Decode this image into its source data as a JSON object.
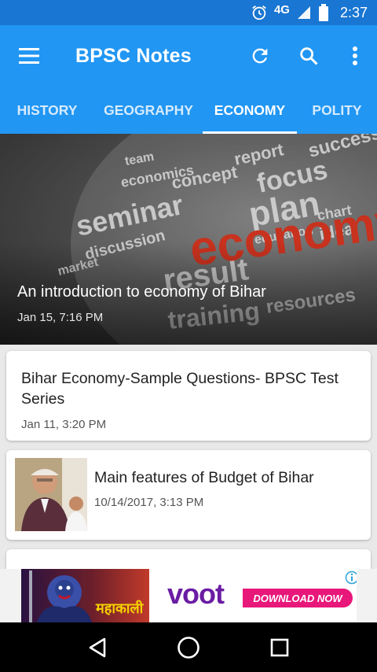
{
  "status_bar": {
    "network": "4G",
    "time": "2:37"
  },
  "app_bar": {
    "title": "BPSC Notes",
    "icons": [
      "menu-icon",
      "refresh-icon",
      "search-icon",
      "more-vert-icon"
    ]
  },
  "tabs": [
    {
      "label": "HISTORY",
      "active": false
    },
    {
      "label": "GEOGRAPHY",
      "active": false
    },
    {
      "label": "ECONOMY",
      "active": true
    },
    {
      "label": "POLITY",
      "active": false
    }
  ],
  "featured": {
    "title": "An introduction to economy of Bihar",
    "date": "Jan 15, 7:16 PM",
    "image_words": [
      "report",
      "success",
      "concept",
      "focus",
      "plan",
      "team",
      "seminar",
      "economy",
      "education",
      "chart",
      "idea",
      "discussion",
      "market",
      "result",
      "resources",
      "training",
      "economics"
    ]
  },
  "posts": [
    {
      "title": "Bihar Economy-Sample Questions- BPSC Test Series",
      "date": "Jan 11, 3:20 PM",
      "has_thumbnail": false
    },
    {
      "title": "Main features of Budget of Bihar",
      "date": "10/14/2017, 3:13 PM",
      "has_thumbnail": true
    },
    {
      "title": "",
      "date": "",
      "has_thumbnail": true
    }
  ],
  "ad": {
    "hindi_text": "महाकाली",
    "brand": "voot",
    "cta": "DOWNLOAD NOW"
  },
  "colors": {
    "primary": "#2196f3",
    "primary_dark": "#1976d2",
    "ad_brand": "#6a1ca3",
    "ad_cta": "#e8177a"
  }
}
